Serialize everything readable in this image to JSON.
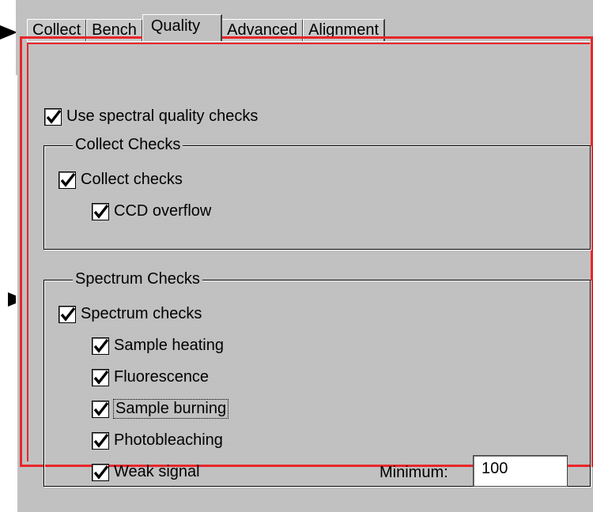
{
  "tabs": [
    {
      "label": "Collect",
      "active": false
    },
    {
      "label": "Bench",
      "active": false
    },
    {
      "label": "Quality",
      "active": true
    },
    {
      "label": "Advanced",
      "active": false
    },
    {
      "label": "Alignment",
      "active": false
    }
  ],
  "quality": {
    "use_checks": {
      "label": "Use spectral quality checks",
      "checked": true
    },
    "collect_group": {
      "title": "Collect Checks",
      "collect_checks": {
        "label": "Collect checks",
        "checked": true
      },
      "ccd_overflow": {
        "label": "CCD overflow",
        "checked": true
      }
    },
    "spectrum_group": {
      "title": "Spectrum Checks",
      "spectrum_checks": {
        "label": "Spectrum checks",
        "checked": true
      },
      "sample_heating": {
        "label": "Sample heating",
        "checked": true
      },
      "fluorescence": {
        "label": "Fluorescence",
        "checked": true
      },
      "sample_burning": {
        "label": "Sample burning",
        "checked": true,
        "focused": true
      },
      "photobleaching": {
        "label": "Photobleaching",
        "checked": true
      },
      "weak_signal": {
        "label": "Weak signal",
        "checked": true
      },
      "minimum": {
        "label": "Minimum:",
        "value": "100"
      }
    }
  },
  "colors": {
    "dialog_bg": "#c0c0c0",
    "highlight": "#e8262a"
  },
  "icons": {
    "checkmark": "check-icon",
    "pointer": "arrow-pointer-icon"
  }
}
